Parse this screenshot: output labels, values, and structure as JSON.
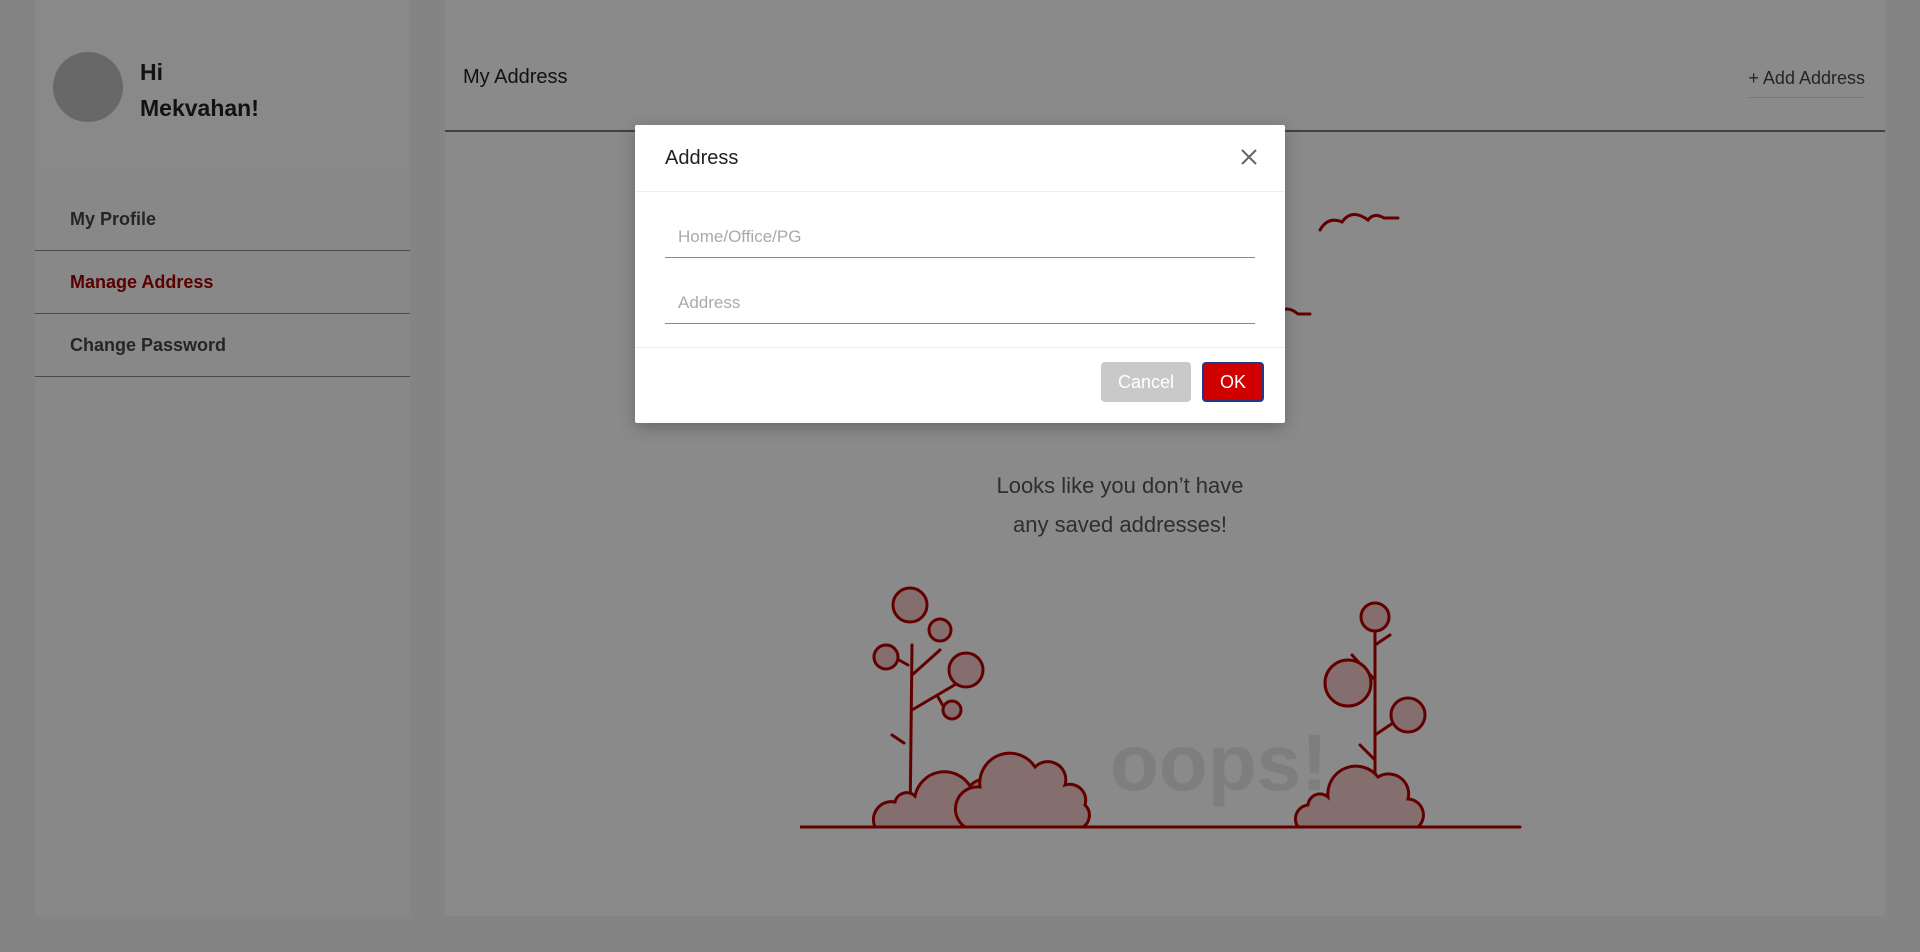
{
  "sidebar": {
    "greeting_line1": "Hi",
    "greeting_line2": "Mekvahan!",
    "items": [
      {
        "label": "My Profile",
        "active": false
      },
      {
        "label": "Manage Address",
        "active": true
      },
      {
        "label": "Change Password",
        "active": false
      }
    ]
  },
  "main": {
    "title": "My Address",
    "add_address_label": "+ Add Address",
    "empty_message_line1": "Looks like you don’t have",
    "empty_message_line2": "any saved addresses!",
    "illustration_text": "oops!"
  },
  "modal": {
    "title": "Address",
    "close_icon": "close-icon",
    "fields": [
      {
        "placeholder": "Home/Office/PG",
        "value": ""
      },
      {
        "placeholder": "Address",
        "value": ""
      }
    ],
    "cancel_label": "Cancel",
    "ok_label": "OK"
  },
  "colors": {
    "accent": "#d10000",
    "active_menu": "#a30000",
    "illustration": "#b30000"
  }
}
